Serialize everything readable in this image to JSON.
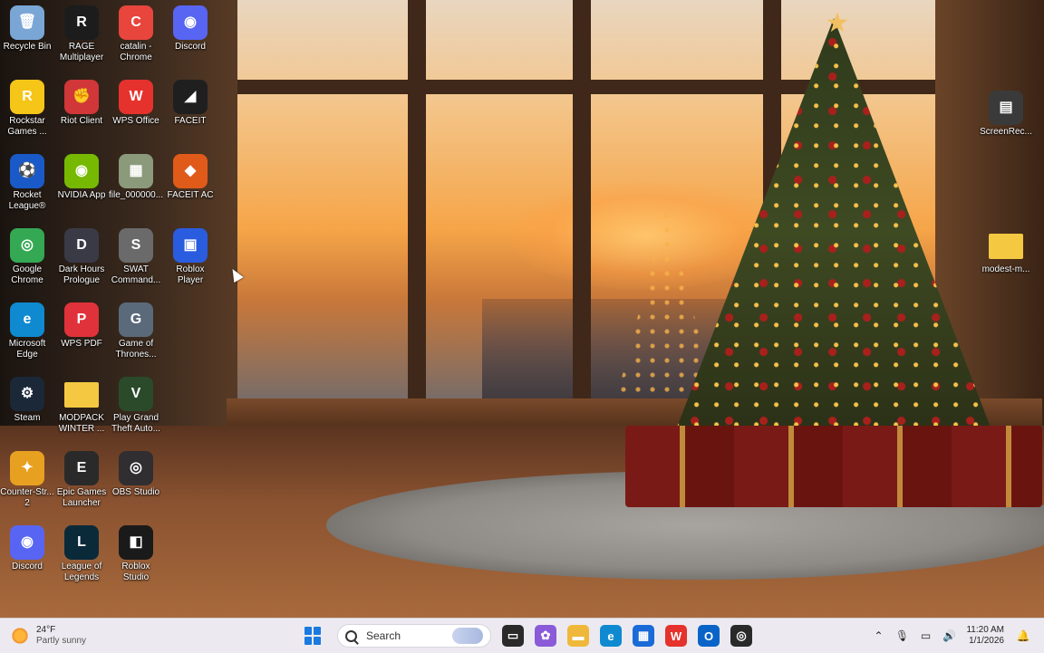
{
  "desktop": {
    "icons": [
      {
        "label": "Recycle Bin",
        "icon": "recycle-bin-icon",
        "color": "#7aa6d6",
        "glyph": "🗑"
      },
      {
        "label": "RAGE Multiplayer",
        "icon": "rage-mp-icon",
        "color": "#1c1c1c",
        "glyph": "R"
      },
      {
        "label": "catalin - Chrome",
        "icon": "chrome-profile-icon",
        "color": "#e8453c",
        "glyph": "C"
      },
      {
        "label": "Discord",
        "icon": "discord-icon",
        "color": "#5865f2",
        "glyph": "◉"
      },
      {
        "label": "Rockstar Games ...",
        "icon": "rockstar-icon",
        "color": "#f5c518",
        "glyph": "R"
      },
      {
        "label": "Riot Client",
        "icon": "riot-client-icon",
        "color": "#d13639",
        "glyph": "✊"
      },
      {
        "label": "WPS Office",
        "icon": "wps-office-icon",
        "color": "#e5322d",
        "glyph": "W"
      },
      {
        "label": "FACEIT",
        "icon": "faceit-icon",
        "color": "#1f1f1f",
        "glyph": "◢"
      },
      {
        "label": "Rocket League®",
        "icon": "rocket-league-icon",
        "color": "#1a5ac8",
        "glyph": "⚽"
      },
      {
        "label": "NVIDIA App",
        "icon": "nvidia-icon",
        "color": "#76b900",
        "glyph": "◉"
      },
      {
        "label": "file_000000...",
        "icon": "image-file-icon",
        "color": "#8a9a7a",
        "glyph": "▦"
      },
      {
        "label": "FACEIT AC",
        "icon": "faceit-ac-icon",
        "color": "#e05a1a",
        "glyph": "◆"
      },
      {
        "label": "Google Chrome",
        "icon": "chrome-icon",
        "color": "#34a853",
        "glyph": "◎"
      },
      {
        "label": "Dark Hours Prologue",
        "icon": "dark-hours-icon",
        "color": "#3a3a46",
        "glyph": "D"
      },
      {
        "label": "SWAT Command...",
        "icon": "swat-icon",
        "color": "#6a6a6a",
        "glyph": "S"
      },
      {
        "label": "Roblox Player",
        "icon": "roblox-player-icon",
        "color": "#2a5ce0",
        "glyph": "▣"
      },
      {
        "label": "Microsoft Edge",
        "icon": "edge-icon",
        "color": "#0f8ad0",
        "glyph": "e"
      },
      {
        "label": "WPS PDF",
        "icon": "wps-pdf-icon",
        "color": "#e0323a",
        "glyph": "P"
      },
      {
        "label": "Game of Thrones...",
        "icon": "game-of-thrones-icon",
        "color": "#5a6a7a",
        "glyph": "G"
      },
      {
        "label": "Steam",
        "icon": "steam-icon",
        "color": "#1b2838",
        "glyph": "⚙"
      },
      {
        "label": "MODPACK WINTER ...",
        "icon": "folder-icon",
        "color": "#f5c842",
        "glyph": ""
      },
      {
        "label": "Play Grand Theft Auto...",
        "icon": "gta-icon",
        "color": "#2a4a2a",
        "glyph": "V"
      },
      {
        "label": "Counter-Str... 2",
        "icon": "counter-strike-icon",
        "color": "#e8a020",
        "glyph": "✦"
      },
      {
        "label": "Epic Games Launcher",
        "icon": "epic-games-icon",
        "color": "#2a2a2a",
        "glyph": "E"
      },
      {
        "label": "OBS Studio",
        "icon": "obs-icon",
        "color": "#302e31",
        "glyph": "◎"
      },
      {
        "label": "Discord",
        "icon": "discord-icon",
        "color": "#5865f2",
        "glyph": "◉"
      },
      {
        "label": "League of Legends",
        "icon": "league-icon",
        "color": "#0a2a3a",
        "glyph": "L"
      },
      {
        "label": "Roblox Studio",
        "icon": "roblox-studio-icon",
        "color": "#1a1a1a",
        "glyph": "◧"
      },
      {
        "label": "ScreenRec...",
        "icon": "video-file-icon",
        "color": "#3a3a3a",
        "glyph": "▤"
      },
      {
        "label": "modest-m...",
        "icon": "folder-icon",
        "color": "#f5c842",
        "glyph": ""
      }
    ]
  },
  "taskbar": {
    "weather": {
      "temp": "24°F",
      "condition": "Partly sunny"
    },
    "search_placeholder": "Search",
    "pinned": [
      {
        "icon": "task-view-icon",
        "color": "#2a2a2a",
        "glyph": "▭"
      },
      {
        "icon": "copilot-icon",
        "color": "#8a5ad8",
        "glyph": "✿"
      },
      {
        "icon": "file-explorer-icon",
        "color": "#f0b83a",
        "glyph": "▬"
      },
      {
        "icon": "edge-icon",
        "color": "#0f8ad0",
        "glyph": "e"
      },
      {
        "icon": "microsoft-store-icon",
        "color": "#1a6ad8",
        "glyph": "▦"
      },
      {
        "icon": "wps-office-icon",
        "color": "#e5322d",
        "glyph": "W"
      },
      {
        "icon": "outlook-icon",
        "color": "#0a64c8",
        "glyph": "O"
      },
      {
        "icon": "chrome-profile-icon",
        "color": "#2a2a2a",
        "glyph": "◎"
      }
    ],
    "clock": {
      "time": "11:20 AM",
      "date": "1/1/2026"
    }
  }
}
